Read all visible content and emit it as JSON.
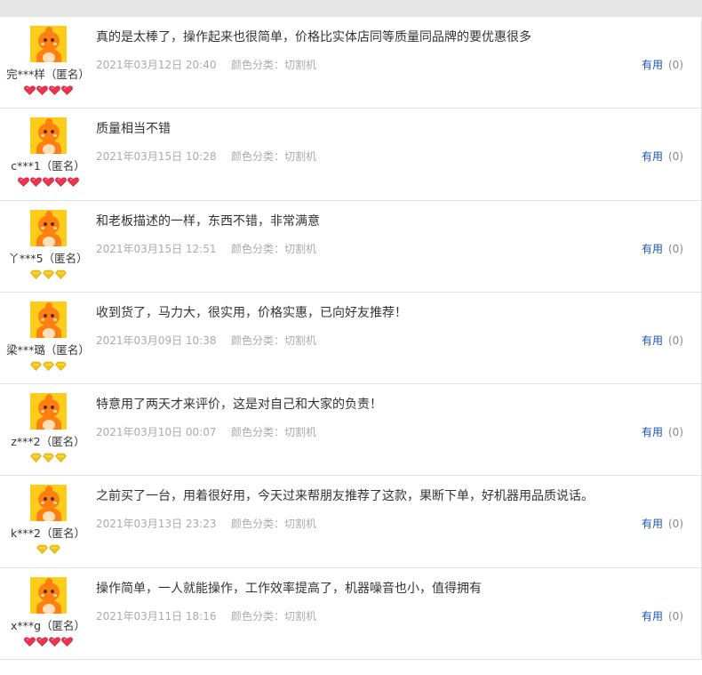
{
  "reviews": [
    {
      "nick": "完***样（匿名）",
      "content": "真的是太棒了，操作起来也很简单，价格比实体店同等质量同品牌的要优惠很多",
      "date": "2021年03月12日 20:40",
      "sku": "颜色分类：切割机",
      "useful_label": "有用",
      "useful_count": "(0)",
      "badge_type": "red-heart",
      "badge_count": 4
    },
    {
      "nick": "c***1（匿名）",
      "content": "质量相当不错",
      "date": "2021年03月15日 10:28",
      "sku": "颜色分类：切割机",
      "useful_label": "有用",
      "useful_count": "(0)",
      "badge_type": "red-heart",
      "badge_count": 5
    },
    {
      "nick": "丫***5（匿名）",
      "content": "和老板描述的一样，东西不错，非常满意",
      "date": "2021年03月15日 12:51",
      "sku": "颜色分类：切割机",
      "useful_label": "有用",
      "useful_count": "(0)",
      "badge_type": "gold-diamond",
      "badge_count": 3
    },
    {
      "nick": "梁***璐（匿名）",
      "content": "收到货了，马力大，很实用，价格实惠，已向好友推荐！",
      "date": "2021年03月09日 10:38",
      "sku": "颜色分类：切割机",
      "useful_label": "有用",
      "useful_count": "(0)",
      "badge_type": "gold-diamond",
      "badge_count": 3
    },
    {
      "nick": "z***2（匿名）",
      "content": "特意用了两天才来评价，这是对自己和大家的负责！",
      "date": "2021年03月10日 00:07",
      "sku": "颜色分类：切割机",
      "useful_label": "有用",
      "useful_count": "(0)",
      "badge_type": "gold-diamond",
      "badge_count": 3
    },
    {
      "nick": "k***2（匿名）",
      "content": "之前买了一台，用着很好用，今天过来帮朋友推荐了这款，果断下单，好机器用品质说话。",
      "date": "2021年03月13日 23:23",
      "sku": "颜色分类：切割机",
      "useful_label": "有用",
      "useful_count": "(0)",
      "badge_type": "gold-diamond",
      "badge_count": 2
    },
    {
      "nick": "x***g（匿名）",
      "content": "操作简单，一人就能操作，工作效率提高了，机器噪音也小，值得拥有",
      "date": "2021年03月11日 18:16",
      "sku": "颜色分类：切割机",
      "useful_label": "有用",
      "useful_count": "(0)",
      "badge_type": "red-heart",
      "badge_count": 4
    }
  ],
  "colors": {
    "useful_link": "#1a55b2",
    "meta_text": "#aaaaaa",
    "red_heart": "#f0334d",
    "gold_diamond": "#f5c20c",
    "avatar_bg": "#ffcc1a"
  }
}
